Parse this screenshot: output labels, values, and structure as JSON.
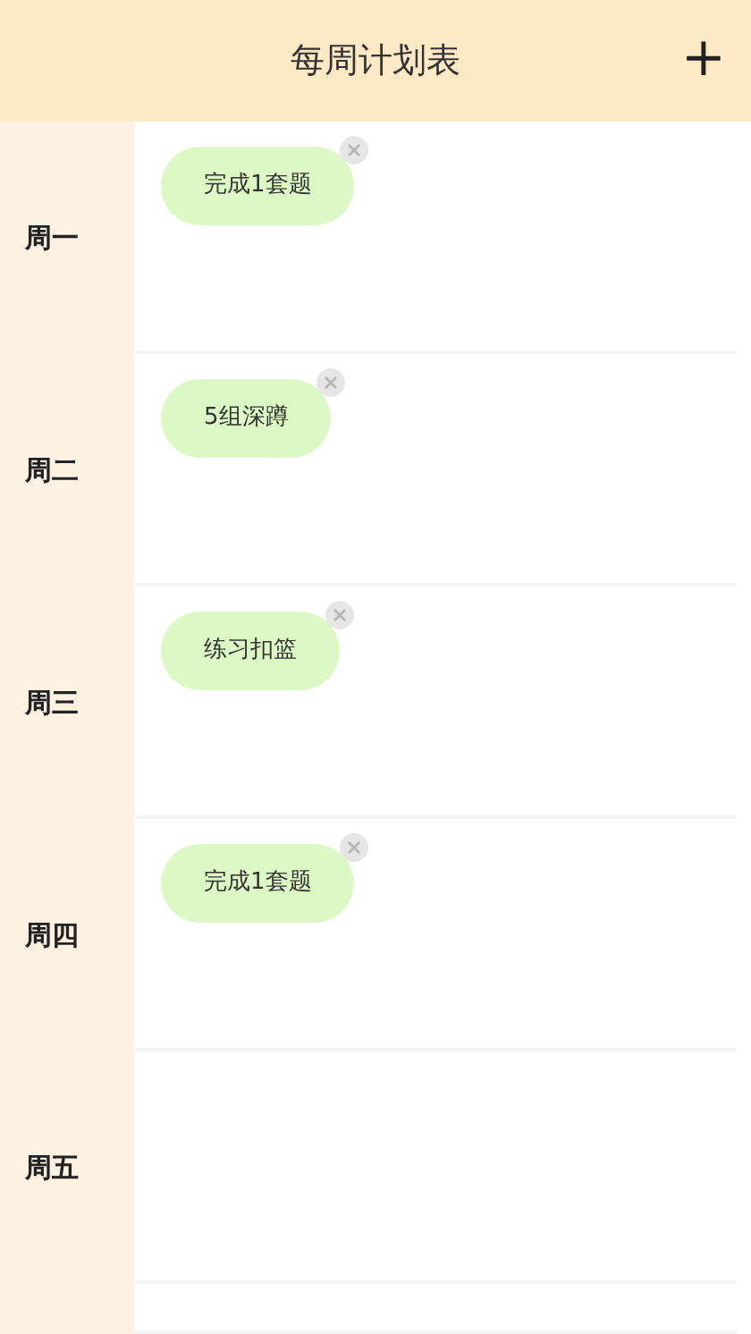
{
  "header": {
    "title": "每周计划表",
    "add_label": "+"
  },
  "days": [
    {
      "label": "周一",
      "tasks": [
        "完成1套题"
      ]
    },
    {
      "label": "周二",
      "tasks": [
        "5组深蹲"
      ]
    },
    {
      "label": "周三",
      "tasks": [
        "练习扣篮"
      ]
    },
    {
      "label": "周四",
      "tasks": [
        "完成1套题"
      ]
    },
    {
      "label": "周五"
    }
  ]
}
